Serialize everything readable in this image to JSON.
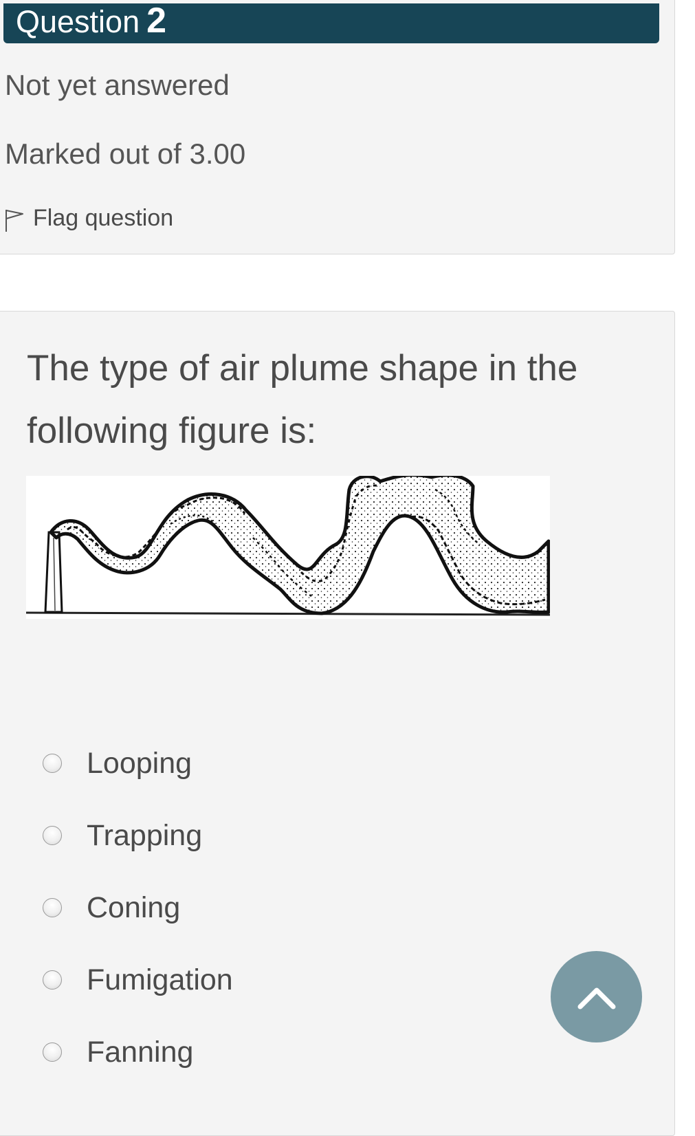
{
  "question_info": {
    "header_word": "Question",
    "number": "2",
    "state": "Not yet answered",
    "grade": "Marked out of 3.00",
    "flag_label": "Flag question"
  },
  "question": {
    "text": "The type of air plume shape in the following figure is:",
    "figure_icon": "plume-figure-image"
  },
  "answers": [
    {
      "label": "Looping",
      "selected": false
    },
    {
      "label": "Trapping",
      "selected": false
    },
    {
      "label": "Coning",
      "selected": false
    },
    {
      "label": "Fumigation",
      "selected": false
    },
    {
      "label": "Fanning",
      "selected": false
    }
  ],
  "scroll_top": {
    "icon": "chevron-up-icon",
    "color": "#7a9aa4"
  },
  "colors": {
    "header_bg": "#174556",
    "panel_bg": "#f4f4f4",
    "text": "#4a4a4a"
  }
}
